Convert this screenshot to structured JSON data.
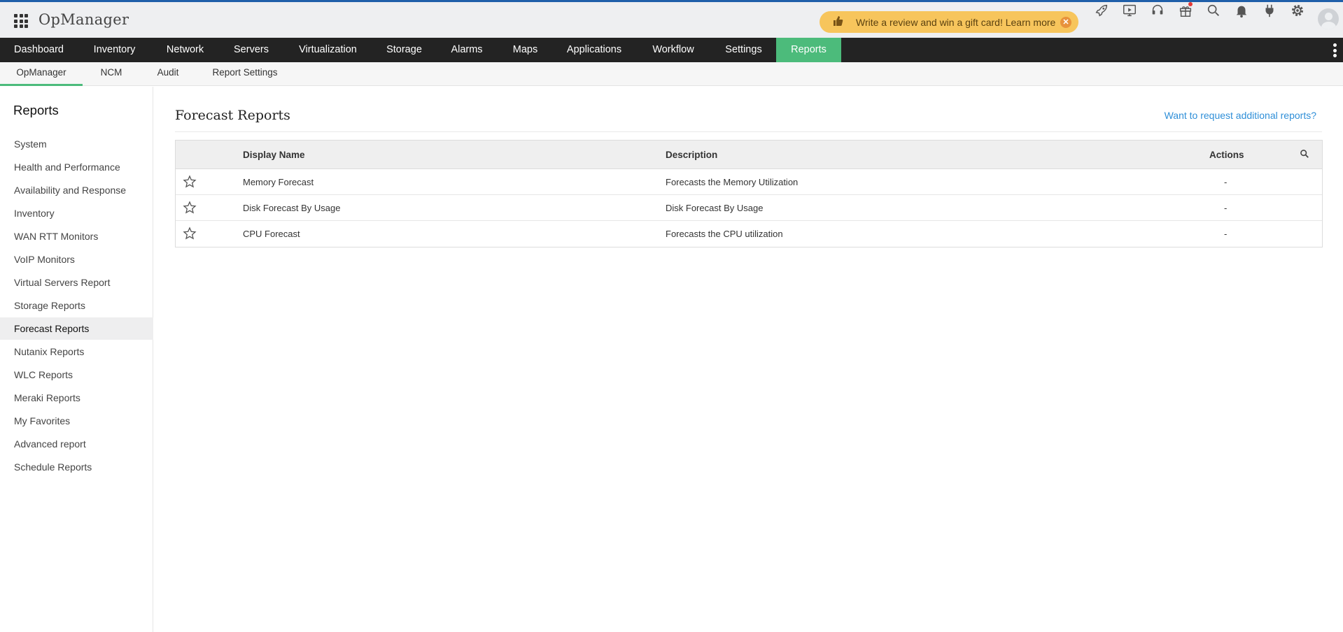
{
  "header": {
    "logo": "OpManager",
    "promo": {
      "text": "Write a review and win a gift card! Learn more",
      "close": "✕"
    },
    "icons": [
      "rocket-icon",
      "screen-icon",
      "headset-icon",
      "gift-icon",
      "search-icon",
      "bell-icon",
      "plug-icon",
      "gear-icon"
    ],
    "accent_color": "#1f5fa9",
    "promo_color": "#f7c55c"
  },
  "main_nav": {
    "items": [
      "Dashboard",
      "Inventory",
      "Network",
      "Servers",
      "Virtualization",
      "Storage",
      "Alarms",
      "Maps",
      "Applications",
      "Workflow",
      "Settings",
      "Reports"
    ],
    "active": "Reports",
    "active_color": "#4cbb7b"
  },
  "sub_nav": {
    "items": [
      "OpManager",
      "NCM",
      "Audit",
      "Report Settings"
    ],
    "active": "OpManager"
  },
  "sidebar": {
    "title": "Reports",
    "items": [
      "System",
      "Health and Performance",
      "Availability and Response",
      "Inventory",
      "WAN RTT Monitors",
      "VoIP Monitors",
      "Virtual Servers Report",
      "Storage Reports",
      "Forecast Reports",
      "Nutanix Reports",
      "WLC Reports",
      "Meraki Reports",
      "My Favorites",
      "Advanced report",
      "Schedule Reports"
    ],
    "active": "Forecast Reports"
  },
  "content": {
    "title": "Forecast Reports",
    "request_link": "Want to request additional reports?",
    "table": {
      "columns": [
        "Display Name",
        "Description",
        "Actions"
      ],
      "rows": [
        {
          "name": "Memory Forecast",
          "description": "Forecasts the Memory Utilization",
          "actions": "-"
        },
        {
          "name": "Disk Forecast By Usage",
          "description": "Disk Forecast By Usage",
          "actions": "-"
        },
        {
          "name": "CPU Forecast",
          "description": "Forecasts the CPU utilization",
          "actions": "-"
        }
      ]
    }
  }
}
